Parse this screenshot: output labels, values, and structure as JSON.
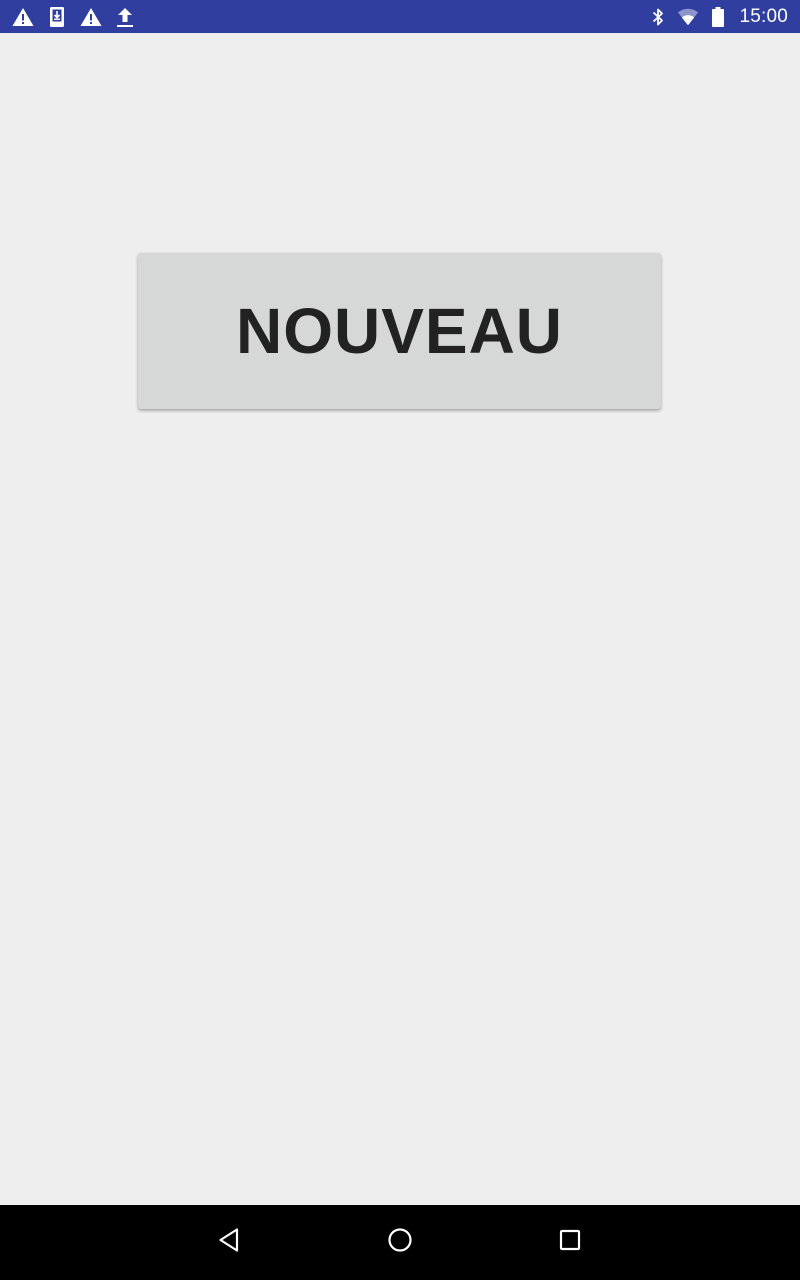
{
  "status_bar": {
    "background": "#303f9f",
    "left_icons": [
      "warning-icon",
      "download-file-icon",
      "warning-icon",
      "upload-icon"
    ],
    "right_icons": [
      "bluetooth-icon",
      "wifi-icon",
      "battery-icon"
    ],
    "time": "15:00"
  },
  "main": {
    "background": "#eeeeee",
    "button": {
      "label": "NOUVEAU",
      "background": "#d6d7d7",
      "text_color": "#222222"
    }
  },
  "nav_bar": {
    "background": "#000000",
    "buttons": [
      "back-icon",
      "home-icon",
      "recents-icon"
    ]
  }
}
